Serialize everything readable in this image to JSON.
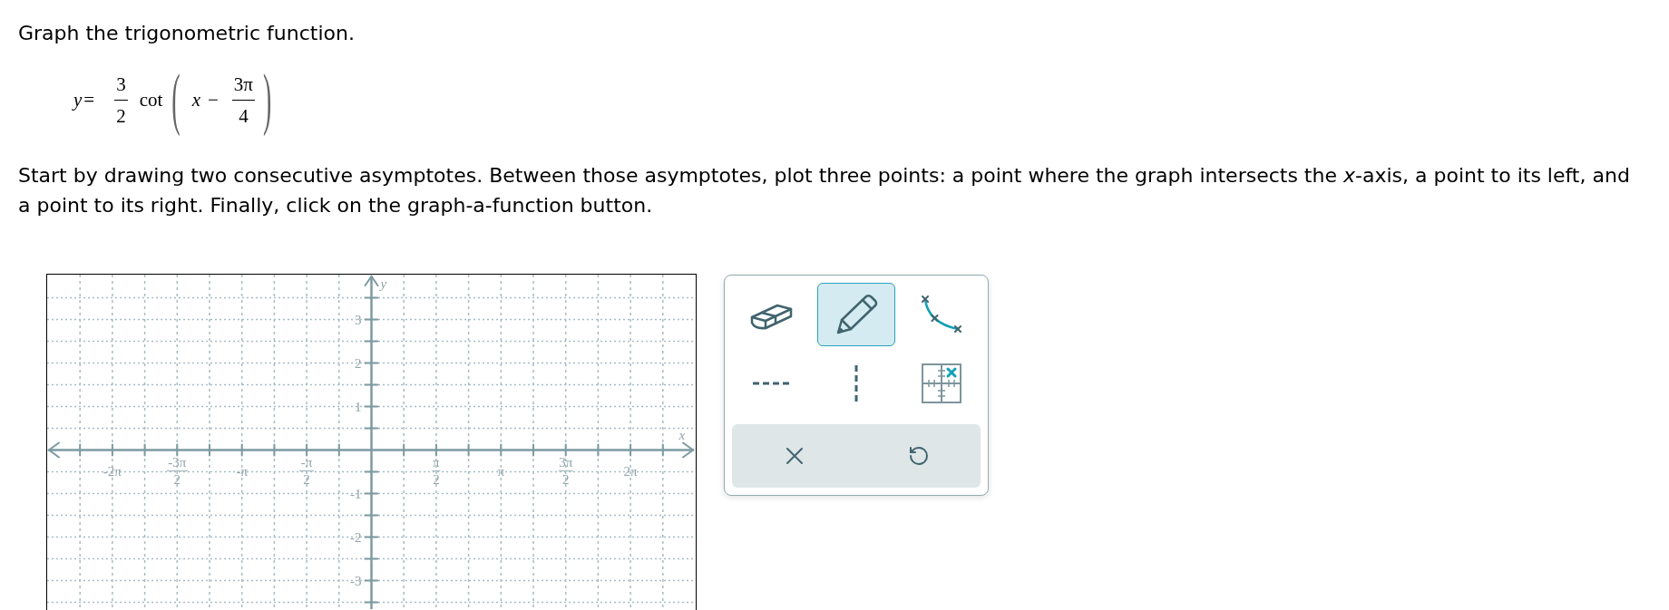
{
  "title": "Graph the trigonometric function.",
  "equation": {
    "lhs": "y",
    "equals": "=",
    "coefficient": {
      "numerator": "3",
      "denominator": "2"
    },
    "function": "cot",
    "open": "(",
    "variable": "x",
    "operator": "−",
    "shift": {
      "numerator": "3π",
      "denominator": "4"
    },
    "close": ")"
  },
  "instructions": "Start by drawing two consecutive asymptotes. Between those asymptotes, plot three points: a point where the graph intersects the *x*-axis, a point to its left, and a point to its right. Finally, click on the graph-a-function button.",
  "graph": {
    "x_axis_label": "x",
    "y_axis_label": "y",
    "x_tick_labels": [
      {
        "kind": "plain",
        "text": "-2π"
      },
      {
        "kind": "fraction",
        "numerator": "-3π",
        "denominator": "2"
      },
      {
        "kind": "plain",
        "text": "-π"
      },
      {
        "kind": "fraction",
        "numerator": "-π",
        "denominator": "2"
      },
      {
        "kind": "fraction",
        "numerator": "π",
        "denominator": "2"
      },
      {
        "kind": "plain",
        "text": "π"
      },
      {
        "kind": "fraction",
        "numerator": "3π",
        "denominator": "2"
      },
      {
        "kind": "plain",
        "text": "2π"
      }
    ],
    "y_tick_labels": [
      "3",
      "2",
      "1",
      "-1",
      "-2",
      "-3"
    ]
  },
  "tools": [
    {
      "kind": "eraser",
      "selected": false
    },
    {
      "kind": "pencil",
      "selected": true
    },
    {
      "kind": "curve",
      "selected": false
    },
    {
      "kind": "horizontal_asymptote",
      "selected": false
    },
    {
      "kind": "vertical_asymptote",
      "selected": false
    },
    {
      "kind": "point_grid",
      "selected": false
    }
  ]
}
